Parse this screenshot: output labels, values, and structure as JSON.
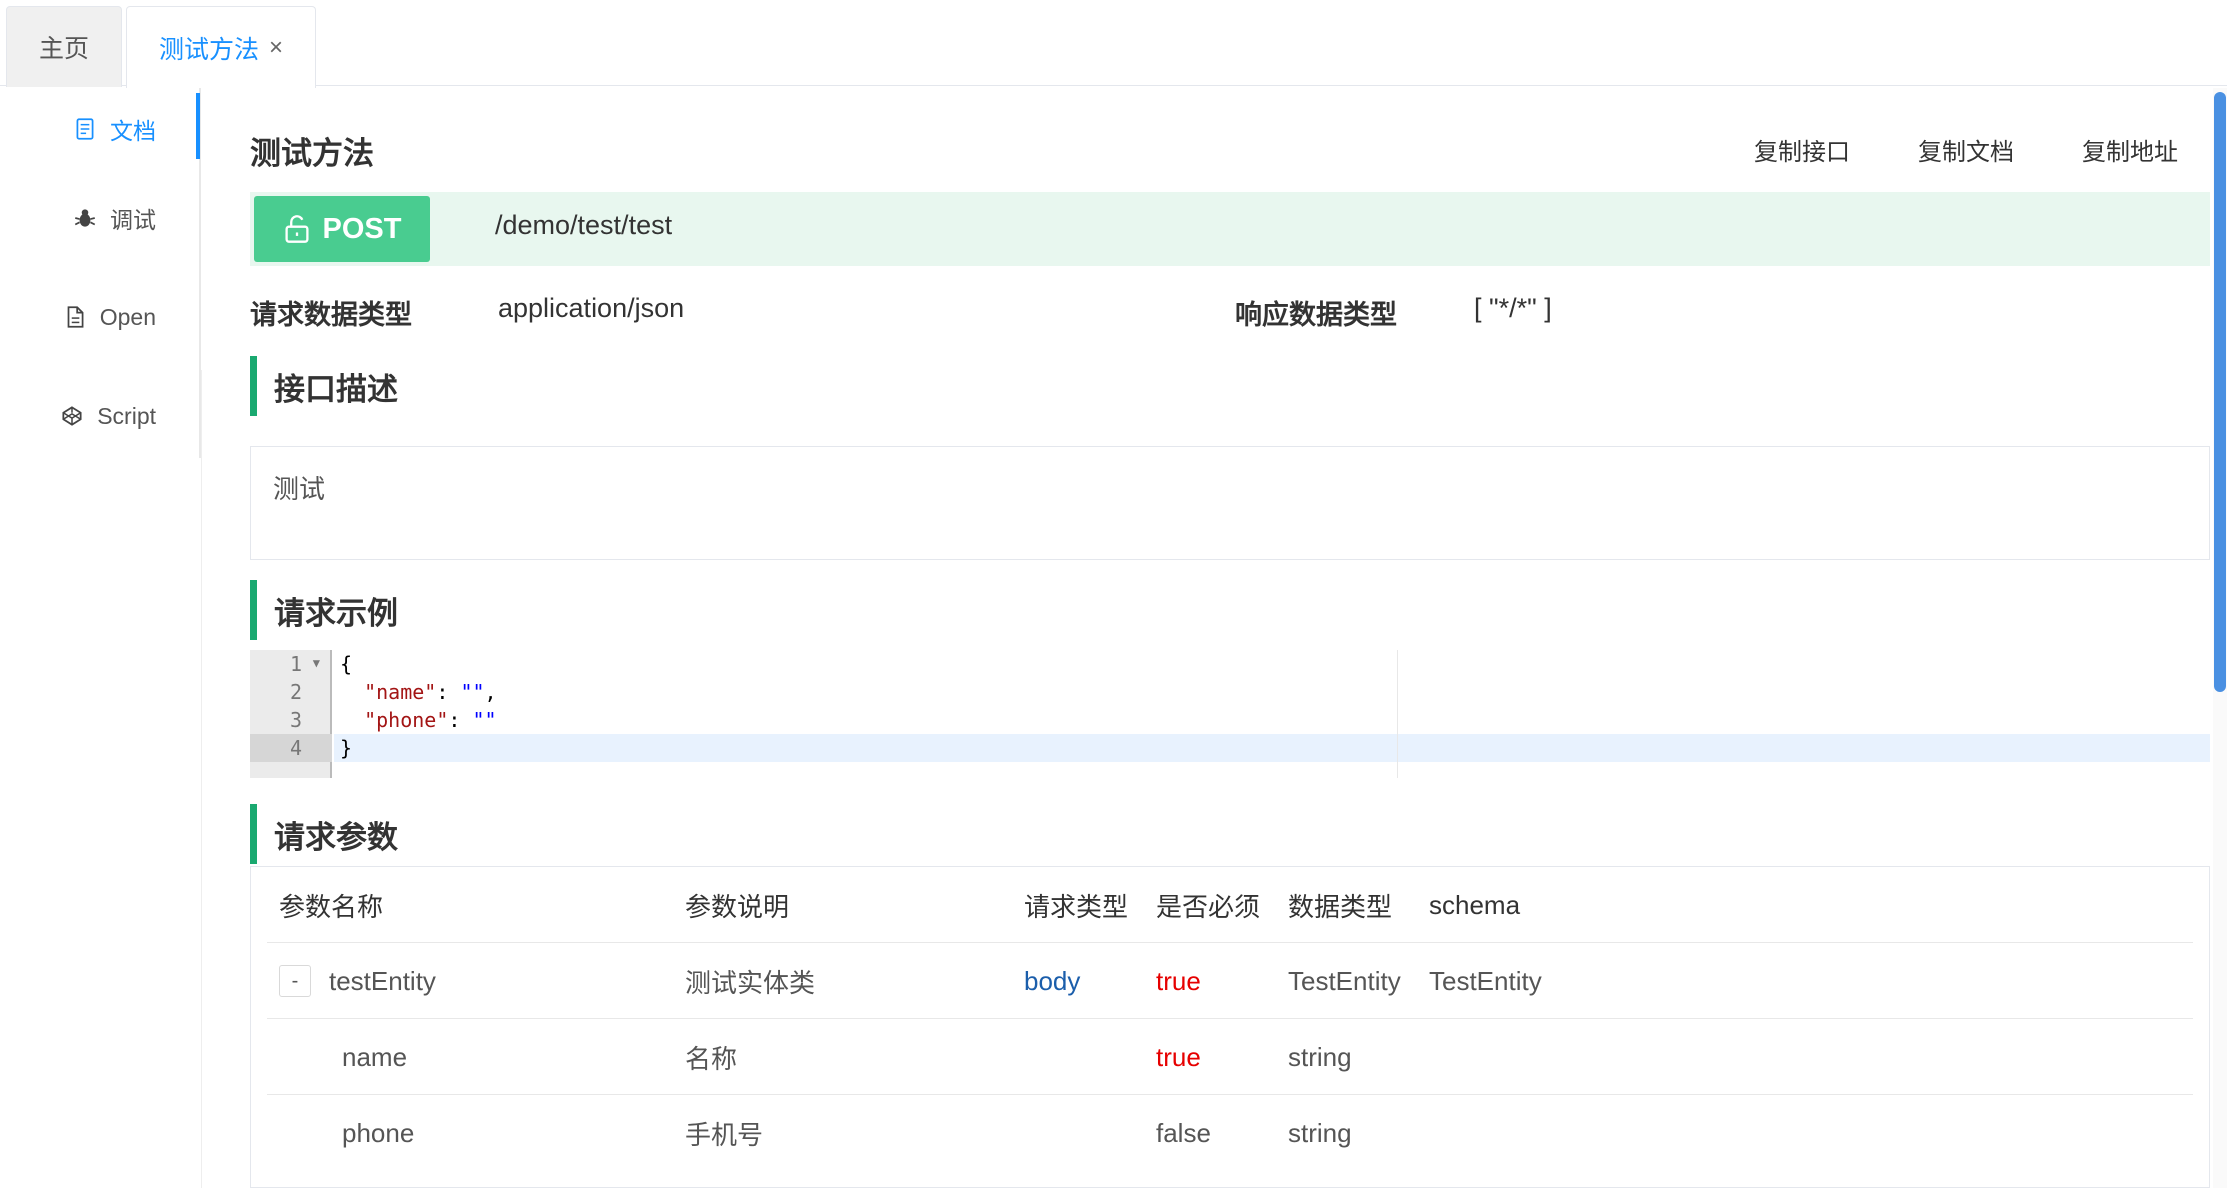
{
  "tabs": [
    {
      "label": "主页"
    },
    {
      "label": "测试方法",
      "close": "×"
    }
  ],
  "menu": [
    {
      "label": "文档",
      "icon": "document-icon",
      "active": true
    },
    {
      "label": "调试",
      "icon": "bug-icon"
    },
    {
      "label": "Open",
      "icon": "file-icon"
    },
    {
      "label": "Script",
      "icon": "codepen-icon"
    }
  ],
  "page": {
    "title": "测试方法",
    "actions": [
      "复制接口",
      "复制文档",
      "复制地址"
    ]
  },
  "endpoint": {
    "method": "POST",
    "path": "/demo/test/test",
    "lock_icon": "unlock-icon",
    "method_color": "#49cc90"
  },
  "content_types": {
    "request_label": "请求数据类型",
    "request_value": "application/json",
    "response_label": "响应数据类型",
    "response_value": "[ \"*/*\" ]"
  },
  "description": {
    "title": "接口描述",
    "text": "测试"
  },
  "request_example": {
    "title": "请求示例",
    "line_numbers": [
      "1",
      "2",
      "3",
      "4"
    ],
    "line1": "{",
    "line2_key": "\"name\"",
    "line2_sep": ": ",
    "line2_val": "\"\"",
    "line2_end": ",",
    "line3_key": "\"phone\"",
    "line3_sep": ": ",
    "line3_val": "\"\"",
    "line4": "}"
  },
  "params": {
    "title": "请求参数",
    "columns": [
      "参数名称",
      "参数说明",
      "请求类型",
      "是否必须",
      "数据类型",
      "schema"
    ],
    "rows": [
      {
        "expand": "-",
        "name": "testEntity",
        "desc": "测试实体类",
        "in": "body",
        "required": "true",
        "type": "TestEntity",
        "schema": "TestEntity"
      },
      {
        "name": "name",
        "desc": "名称",
        "in": "",
        "required": "true",
        "type": "string",
        "schema": ""
      },
      {
        "name": "phone",
        "desc": "手机号",
        "in": "",
        "required": "false",
        "type": "string",
        "schema": ""
      }
    ]
  },
  "colors": {
    "accent": "#1890ff",
    "section_bar": "#1aa970",
    "required_true": "#e60000",
    "body": "#1b5eab"
  }
}
